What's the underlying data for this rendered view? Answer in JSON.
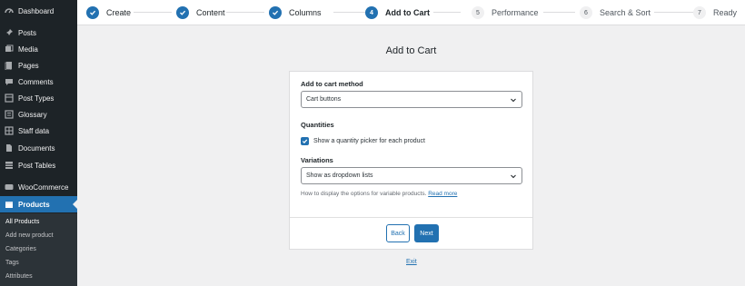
{
  "sidebar": {
    "items": [
      {
        "label": "Dashboard",
        "icon": "dashboard-icon"
      },
      {
        "label": "Posts",
        "icon": "pin-icon"
      },
      {
        "label": "Media",
        "icon": "media-icon"
      },
      {
        "label": "Pages",
        "icon": "pages-icon"
      },
      {
        "label": "Comments",
        "icon": "comment-icon"
      },
      {
        "label": "Post Types",
        "icon": "post-types-icon"
      },
      {
        "label": "Glossary",
        "icon": "glossary-icon"
      },
      {
        "label": "Staff data",
        "icon": "staff-icon"
      },
      {
        "label": "Documents",
        "icon": "document-icon"
      },
      {
        "label": "Post Tables",
        "icon": "table-icon"
      },
      {
        "label": "WooCommerce",
        "icon": "woocommerce-icon"
      },
      {
        "label": "Products",
        "icon": "products-icon"
      }
    ],
    "submenu": [
      "All Products",
      "Add new product",
      "Categories",
      "Tags",
      "Attributes"
    ]
  },
  "steps": [
    {
      "label": "Create",
      "status": "done"
    },
    {
      "label": "Content",
      "status": "done"
    },
    {
      "label": "Columns",
      "status": "done"
    },
    {
      "number": "4",
      "label": "Add to Cart",
      "status": "current"
    },
    {
      "number": "5",
      "label": "Performance",
      "status": "todo"
    },
    {
      "number": "6",
      "label": "Search & Sort",
      "status": "todo"
    },
    {
      "number": "7",
      "label": "Ready",
      "status": "todo"
    }
  ],
  "page": {
    "title": "Add to Cart",
    "add_to_cart_label": "Add to cart method",
    "add_to_cart_value": "Cart buttons",
    "quantities_label": "Quantities",
    "quantity_checkbox_label": "Show a quantity picker for each product",
    "quantity_checked": true,
    "variations_label": "Variations",
    "variations_value": "Show as dropdown lists",
    "variations_help": "How to display the options for variable products.",
    "read_more": "Read more",
    "back_label": "Back",
    "next_label": "Next",
    "exit_label": "Exit"
  },
  "colors": {
    "accent": "#2271b1",
    "sidebar_bg": "#1d2327",
    "page_bg": "#f0f0f1"
  }
}
